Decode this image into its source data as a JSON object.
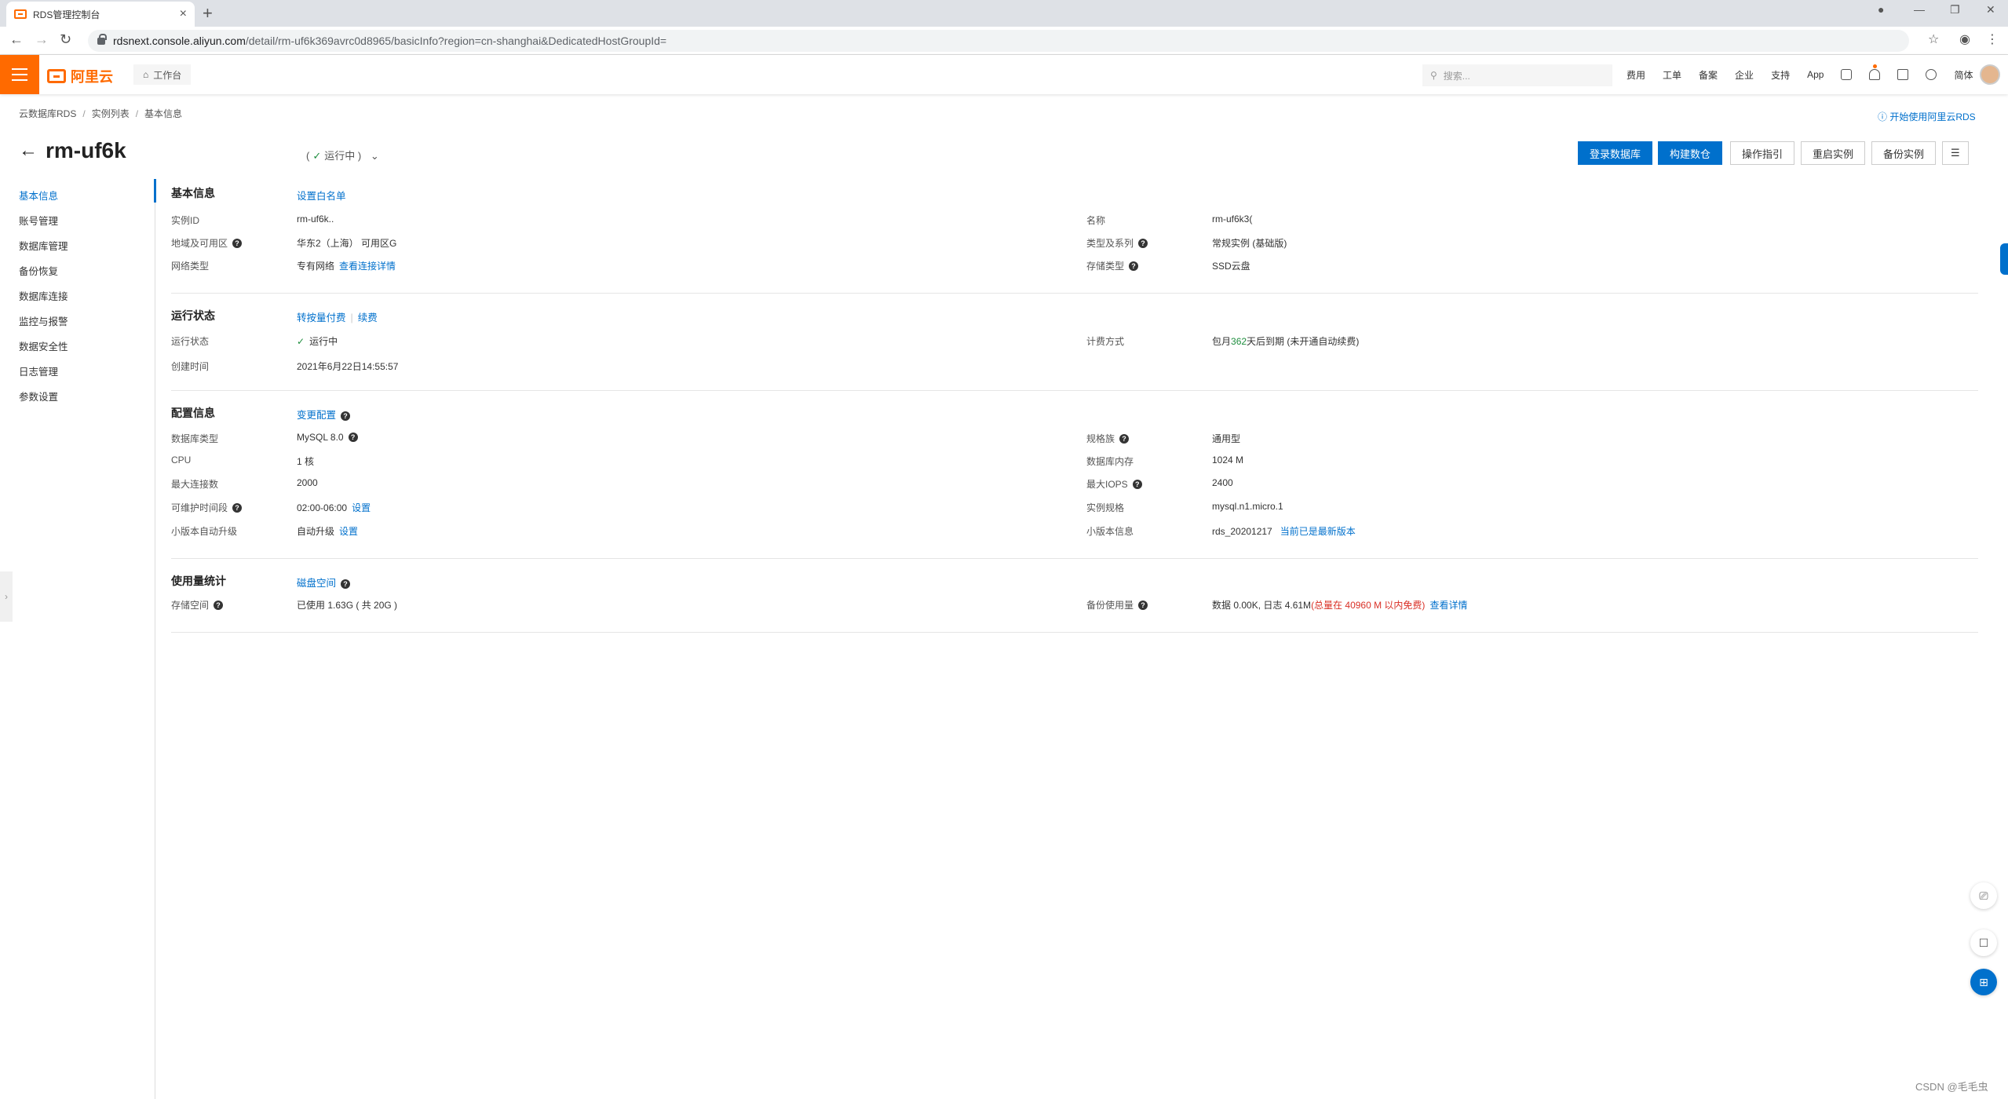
{
  "browser": {
    "tab_title": "RDS管理控制台",
    "url_host": "rdsnext.console.aliyun.com",
    "url_path": "/detail/rm-uf6k369avrc0d8965/basicInfo?region=cn-shanghai&DedicatedHostGroupId="
  },
  "topnav": {
    "logo_text": "阿里云",
    "workspace": "工作台",
    "search_placeholder": "搜索...",
    "links": [
      "费用",
      "工单",
      "备案",
      "企业",
      "支持",
      "App"
    ],
    "lang": "简体"
  },
  "breadcrumb": [
    "云数据库RDS",
    "实例列表",
    "基本信息"
  ],
  "help_link": "开始使用阿里云RDS",
  "header": {
    "instance_name": "rm-uf6k",
    "status_open": "(",
    "status_text": "运行中",
    "status_close": ")"
  },
  "actions": [
    "登录数据库",
    "构建数仓",
    "操作指引",
    "重启实例",
    "备份实例"
  ],
  "leftnav": [
    "基本信息",
    "账号管理",
    "数据库管理",
    "备份恢复",
    "数据库连接",
    "监控与报警",
    "数据安全性",
    "日志管理",
    "参数设置"
  ],
  "basic": {
    "title": "基本信息",
    "link": "设置白名单",
    "instance_id_label": "实例ID",
    "instance_id": "rm-uf6k..",
    "name_label": "名称",
    "name": "rm-uf6k3(",
    "region_label": "地域及可用区",
    "region": "华东2（上海） 可用区G",
    "type_label": "类型及系列",
    "type": "常规实例 (基础版)",
    "network_label": "网络类型",
    "network": "专有网络",
    "network_link": "查看连接详情",
    "storage_label": "存储类型",
    "storage": "SSD云盘"
  },
  "running": {
    "title": "运行状态",
    "link1": "转按量付费",
    "link2": "续费",
    "status_label": "运行状态",
    "status": "运行中",
    "billing_label": "计费方式",
    "billing_pre": "包月",
    "billing_days": "362",
    "billing_post": "天后到期 (未开通自动续费)",
    "created_label": "创建时间",
    "created": "2021年6月22日14:55:57"
  },
  "config": {
    "title": "配置信息",
    "link": "变更配置",
    "db_type_label": "数据库类型",
    "db_type": "MySQL 8.0",
    "family_label": "规格族",
    "family": "通用型",
    "cpu_label": "CPU",
    "cpu": "1 核",
    "memory_label": "数据库内存",
    "memory": "1024 M",
    "maxconn_label": "最大连接数",
    "maxconn": "2000",
    "iops_label": "最大IOPS",
    "iops": "2400",
    "maint_label": "可维护时间段",
    "maint": "02:00-06:00",
    "maint_link": "设置",
    "spec_label": "实例规格",
    "spec": "mysql.n1.micro.1",
    "upgrade_label": "小版本自动升级",
    "upgrade": "自动升级",
    "upgrade_link": "设置",
    "minor_label": "小版本信息",
    "minor": "rds_20201217",
    "minor_link": "当前已是最新版本"
  },
  "usage": {
    "title": "使用量统计",
    "link": "磁盘空间",
    "storage_label": "存储空间",
    "storage": "已使用 1.63G ( 共 20G )",
    "backup_label": "备份使用量",
    "backup_pre": "数据 0.00K, 日志 4.61M",
    "backup_red": "(总量在 40960 M 以内免费)",
    "backup_link": "查看详情"
  },
  "watermark": "CSDN @毛毛虫",
  "colors": {
    "brand": "#ff6a00",
    "accent": "#0070cc",
    "success": "#1e8e3e",
    "danger": "#d93026"
  }
}
